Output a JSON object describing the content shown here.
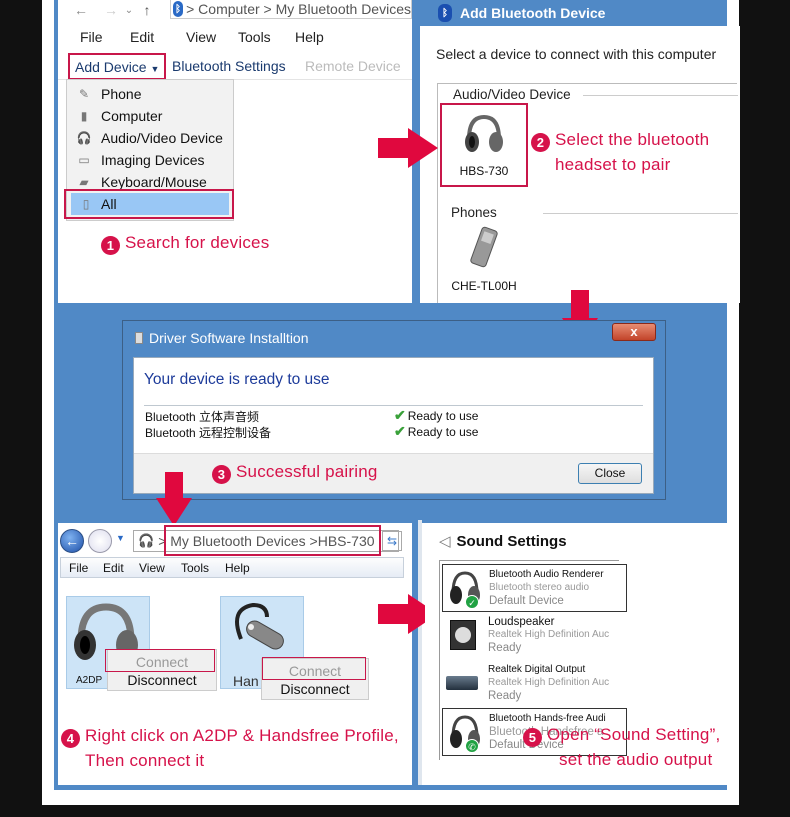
{
  "colors": {
    "accent": "#d6124a",
    "frame_blue": "#5089c6",
    "selection": "#99c7f5"
  },
  "panel1": {
    "nav": {
      "back": "←",
      "forward": "→",
      "recent": "⌄",
      "up": "↑"
    },
    "address": "> Computer > My Bluetooth Devices",
    "menu": [
      "File",
      "Edit",
      "View",
      "Tools",
      "Help"
    ],
    "toolbar": {
      "add_device": "Add Device",
      "bluetooth_settings": "Bluetooth Settings",
      "remote_device": "Remote Device"
    },
    "dropdown": [
      {
        "label": "Phone",
        "icon": "phone-icon"
      },
      {
        "label": "Computer",
        "icon": "computer-icon"
      },
      {
        "label": "Audio/Video Device",
        "icon": "headphones-icon"
      },
      {
        "label": "Imaging Devices",
        "icon": "imaging-icon"
      },
      {
        "label": "Keyboard/Mouse",
        "icon": "keyboard-icon"
      },
      {
        "label": "All",
        "icon": "all-devices-icon",
        "selected": true
      }
    ],
    "step": {
      "num": "1",
      "text": "Search for devices"
    }
  },
  "panel2": {
    "title": "Add Bluetooth Device",
    "prompt": "Select a device to connect with this computer",
    "groups": [
      {
        "label": "Audio/Video Device",
        "devices": [
          {
            "name": "HBS-730",
            "selected": true
          }
        ]
      },
      {
        "label": "Phones",
        "devices": [
          {
            "name": "CHE-TL00H"
          }
        ]
      }
    ],
    "step": {
      "num": "2",
      "line1": "Select the bluetooth",
      "line2": "headset to pair"
    }
  },
  "dialog": {
    "title": "Driver Software Installtion",
    "close_x": "x",
    "heading": "Your device is ready to use",
    "rows": [
      {
        "device": "Bluetooth 立体声音频",
        "status": "Ready to use"
      },
      {
        "device": "Bluetooth 远程控制设备",
        "status": "Ready to use"
      }
    ],
    "close_button": "Close",
    "step": {
      "num": "3",
      "text": "Successful pairing"
    }
  },
  "panel4": {
    "address": "> My Bluetooth Devices >HBS-730",
    "menu": [
      "File",
      "Edit",
      "View",
      "Tools",
      "Help"
    ],
    "profiles": [
      {
        "label": "A2DP",
        "icon": "headphones-icon"
      },
      {
        "label": "Han",
        "icon": "headset-icon"
      }
    ],
    "context_menu": {
      "connect": "Connect",
      "disconnect": "Disconnect"
    },
    "step": {
      "num": "4",
      "line1": "Right click on A2DP & Handsfree Profile,",
      "line2": "Then connect it"
    }
  },
  "panel5": {
    "title": "Sound Settings",
    "devices": [
      {
        "name": "Bluetooth Audio Renderer",
        "sub": "Bluetooth stereo audio",
        "state": "Default Device",
        "badge": "check"
      },
      {
        "name": "Loudspeaker",
        "sub": "Realtek High Definition Auc",
        "state": "Ready"
      },
      {
        "name": "Realtek Digital Output",
        "sub": "Realtek High Definition Auc",
        "state": "Ready"
      },
      {
        "name": "Bluetooth Hands-free Audi",
        "sub": "Bluetooth Handsfree a",
        "state": "Default Device",
        "badge": "phone"
      }
    ],
    "step": {
      "num": "5",
      "line1": "Open “Sound Setting”,",
      "line2": "set the audio output"
    }
  }
}
